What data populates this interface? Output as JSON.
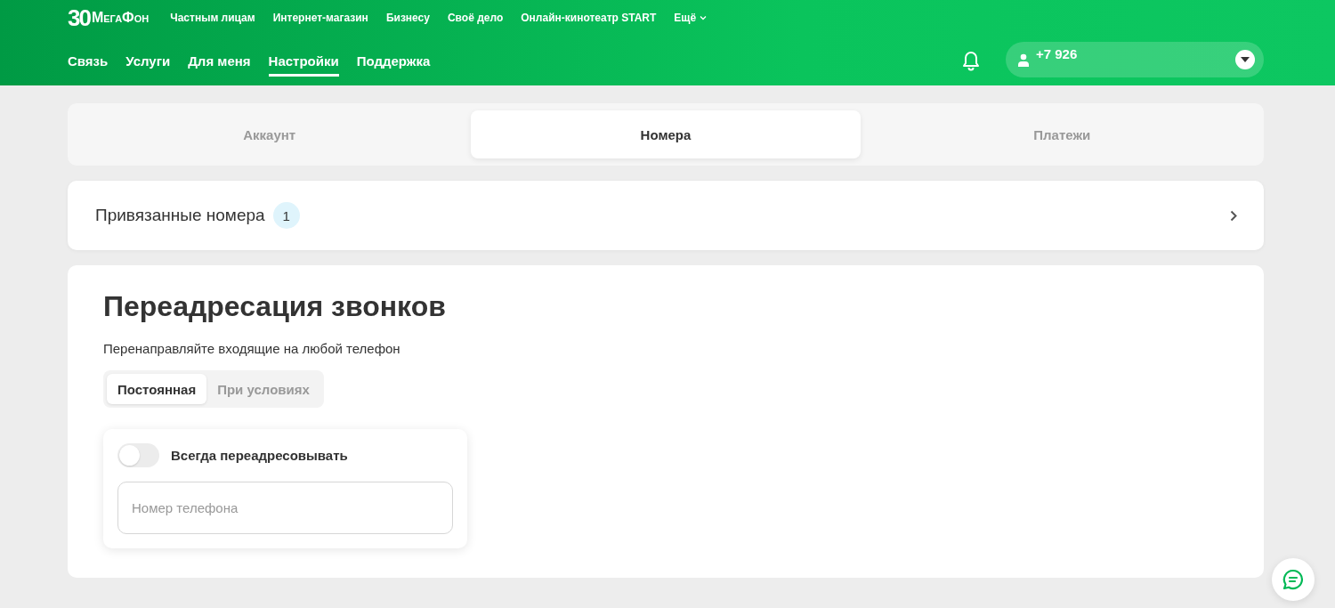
{
  "header": {
    "logo": {
      "number": "30",
      "name": "МегаФон"
    },
    "top_links": [
      {
        "label": "Частным лицам"
      },
      {
        "label": "Интернет-магазин"
      },
      {
        "label": "Бизнесу"
      },
      {
        "label": "Своё дело"
      },
      {
        "label": "Онлайн-кинотеатр START"
      },
      {
        "label": "Ещё",
        "kind": "dropdown"
      }
    ],
    "nav": [
      {
        "label": "Связь",
        "selected": false
      },
      {
        "label": "Услуги",
        "selected": false
      },
      {
        "label": "Для меня",
        "selected": false
      },
      {
        "label": "Настройки",
        "selected": true
      },
      {
        "label": "Поддержка",
        "selected": false
      }
    ],
    "account": {
      "phone": "+7 926"
    }
  },
  "tabs": [
    {
      "label": "Аккаунт",
      "selected": false
    },
    {
      "label": "Номера",
      "selected": true
    },
    {
      "label": "Платежи",
      "selected": false
    }
  ],
  "linked_numbers": {
    "title": "Привязанные номера",
    "count": "1"
  },
  "forwarding": {
    "title": "Переадресация звонков",
    "subtitle": "Перенаправляйте входящие на любой телефон",
    "modes": [
      {
        "label": "Постоянная",
        "selected": true
      },
      {
        "label": "При условиях",
        "selected": false
      }
    ],
    "toggle": {
      "label": "Всегда переадресовывать",
      "on": false
    },
    "phone_field": {
      "placeholder": "Номер телефона"
    }
  }
}
